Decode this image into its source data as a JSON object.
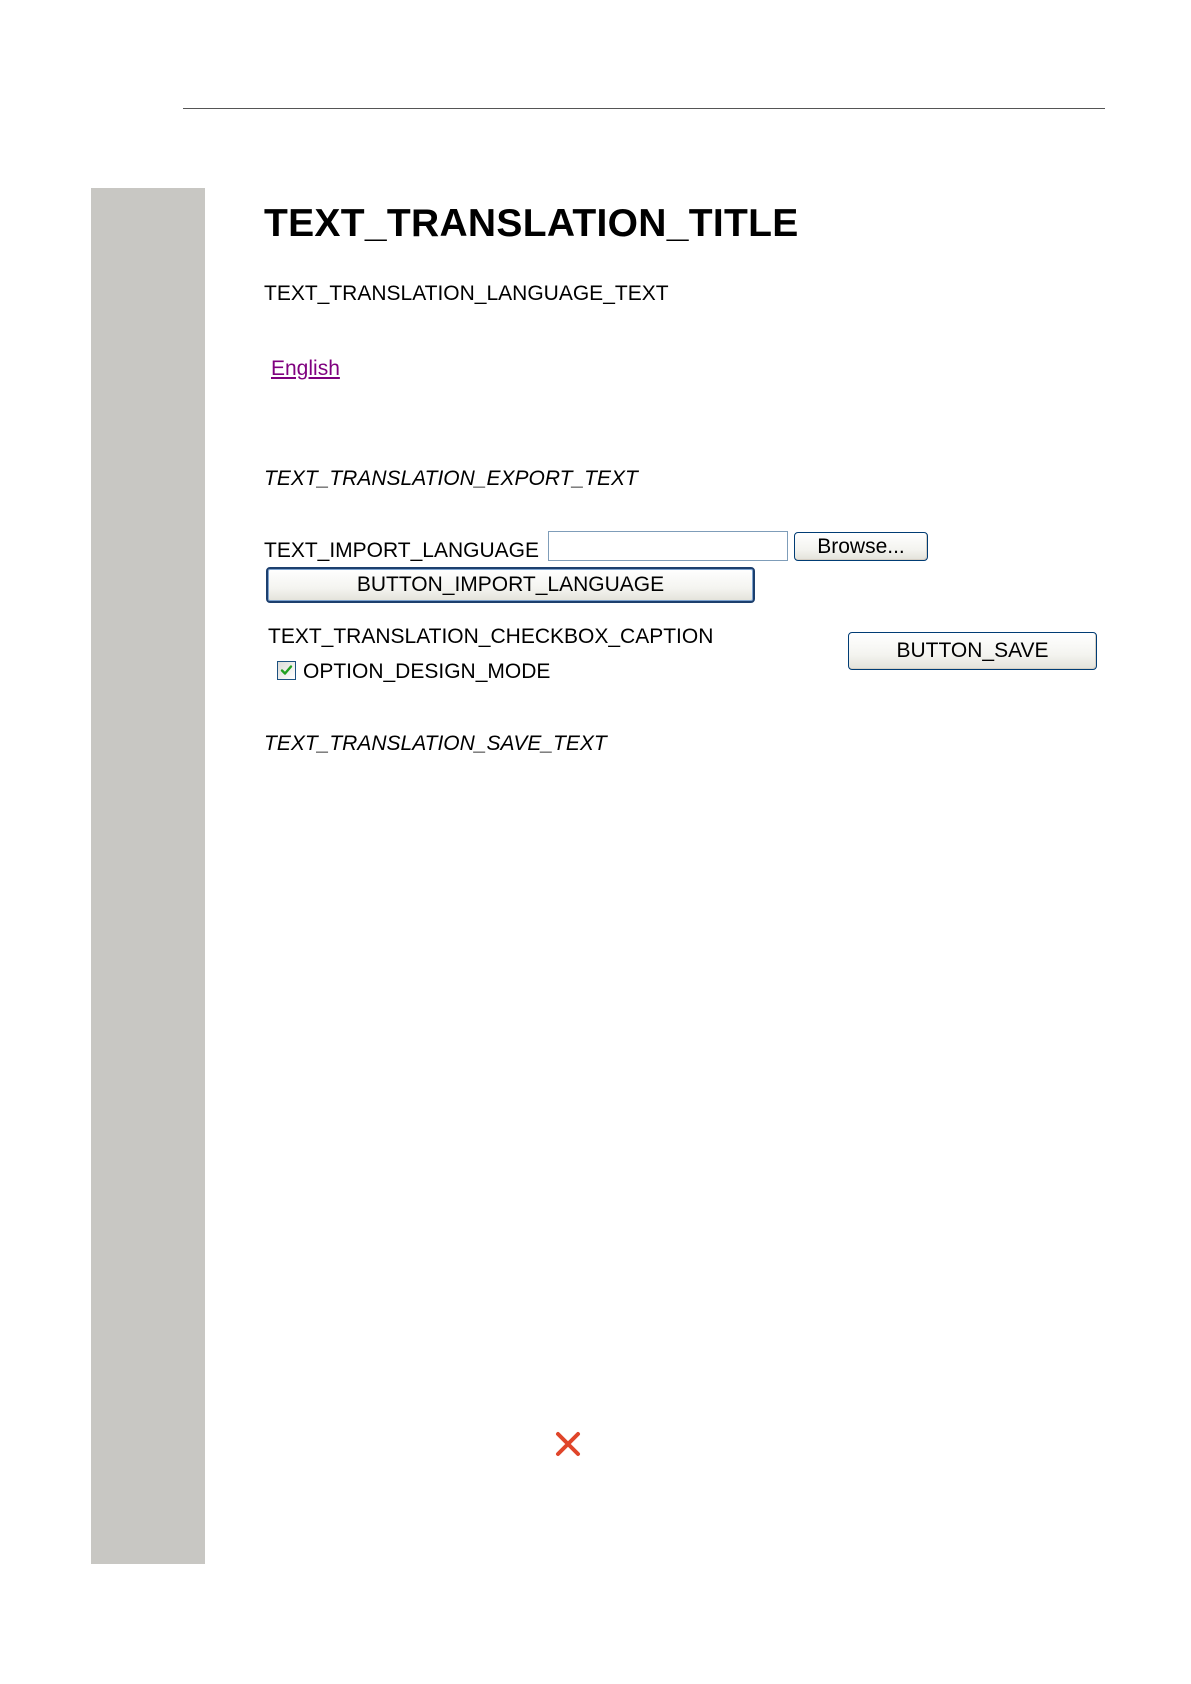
{
  "page": {
    "title": "TEXT_TRANSLATION_TITLE",
    "language_text": "TEXT_TRANSLATION_LANGUAGE_TEXT",
    "language_link": "English",
    "export_text": "TEXT_TRANSLATION_EXPORT_TEXT",
    "import_label": "TEXT_IMPORT_LANGUAGE",
    "import_file_value": "",
    "browse_label": "Browse...",
    "import_button_label": "BUTTON_IMPORT_LANGUAGE",
    "checkbox_caption": "TEXT_TRANSLATION_CHECKBOX_CAPTION",
    "design_mode_label": "OPTION_DESIGN_MODE",
    "design_mode_checked": true,
    "save_button_label": "BUTTON_SAVE",
    "save_text": "TEXT_TRANSLATION_SAVE_TEXT"
  },
  "colors": {
    "sidebar": "#c8c7c3",
    "link_visited": "#7f007f",
    "checkmark": "#21a121",
    "close_icon": "#e0452a"
  },
  "icons": {
    "checkbox": "checkmark-icon",
    "close": "close-icon"
  }
}
